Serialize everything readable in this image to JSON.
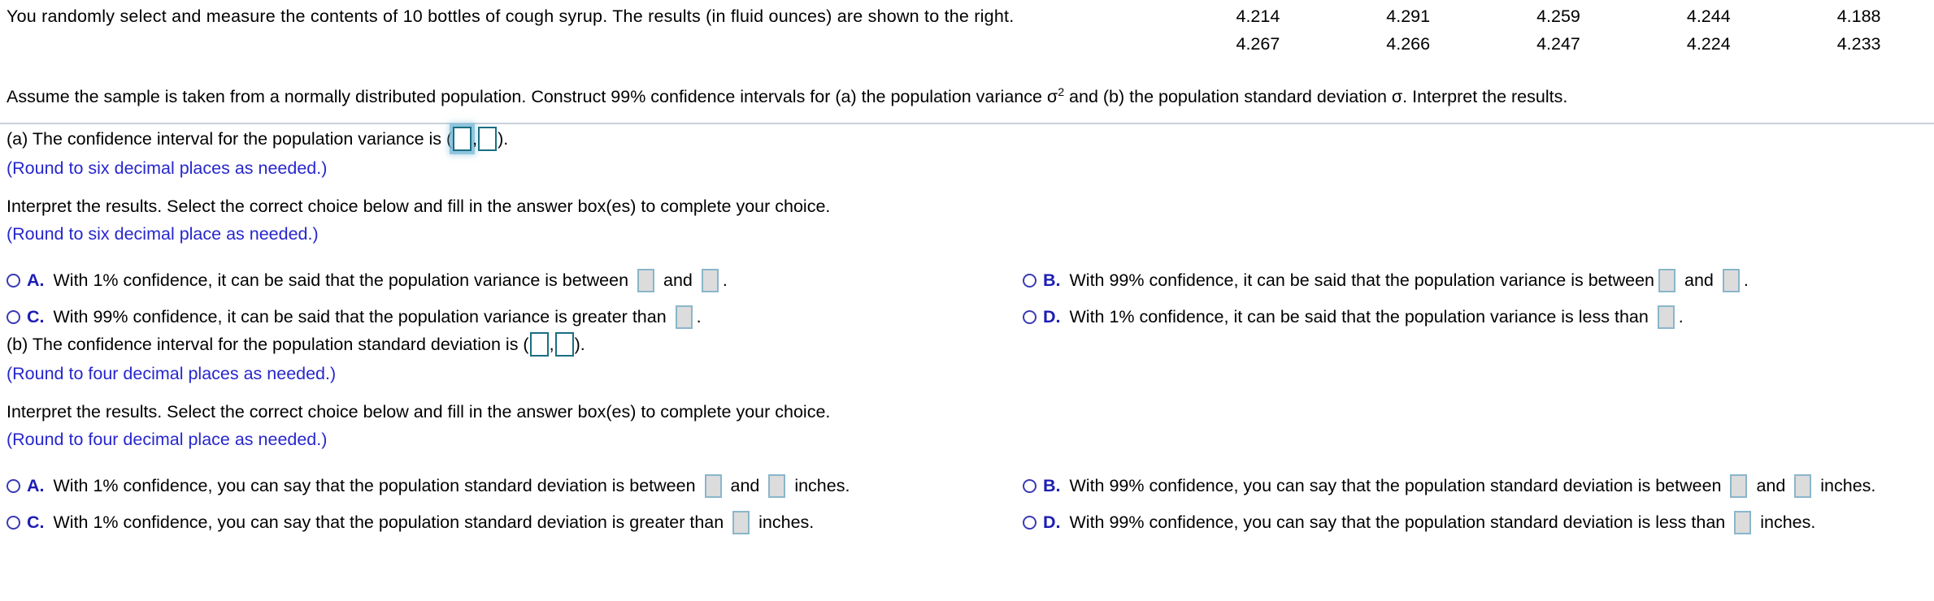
{
  "stem": {
    "text": "You randomly select and measure the contents of 10 bottles of cough syrup. The results (in fluid ounces) are shown to the right.",
    "assume_pre": "Assume the sample is taken from a normally distributed population. Construct 99% confidence intervals for (a) the population variance σ",
    "assume_sup": "2",
    "assume_post": " and (b) the population standard deviation σ. Interpret the results."
  },
  "data_table": {
    "rows": [
      [
        "4.214",
        "4.291",
        "4.259",
        "4.244",
        "4.188"
      ],
      [
        "4.267",
        "4.266",
        "4.247",
        "4.224",
        "4.233"
      ]
    ]
  },
  "part_a": {
    "prompt_pre": "(a) The confidence interval for the population variance is (",
    "prompt_mid": ",",
    "prompt_post": ").",
    "round_hint": "(Round to six decimal places as needed.)",
    "interpret": "Interpret the results. Select the correct choice below and fill in the answer box(es) to complete your choice.",
    "interpret_hint": "(Round to six decimal place as needed.)",
    "choices": [
      {
        "letter": "A.",
        "parts": [
          "With 1% confidence, it can be said that the population variance is between ",
          " and ",
          "."
        ],
        "boxes": 2
      },
      {
        "letter": "B.",
        "parts": [
          "With 99% confidence, it can be said that  the population variance is between",
          " and ",
          "."
        ],
        "boxes": 2
      },
      {
        "letter": "C.",
        "parts": [
          "With 99% confidence, it can be said that the population variance is greater than ",
          "."
        ],
        "boxes": 1
      },
      {
        "letter": "D.",
        "parts": [
          "With 1% confidence, it can be said that the population variance is less than ",
          "."
        ],
        "boxes": 1
      }
    ]
  },
  "part_b": {
    "prompt_pre": "(b) The confidence interval for the population standard deviation is (",
    "prompt_mid": ",",
    "prompt_post": ").",
    "round_hint": "(Round to four decimal places as needed.)",
    "interpret": "Interpret the results. Select the correct choice below and fill in the answer box(es) to complete your choice.",
    "interpret_hint": "(Round to four decimal place as needed.)",
    "choices": [
      {
        "letter": "A.",
        "parts": [
          "With 1% confidence, you can say that the population standard deviation is between ",
          " and ",
          " inches."
        ],
        "boxes": 2
      },
      {
        "letter": "B.",
        "parts": [
          "With 99% confidence, you can say that the population standard deviation is between ",
          " and ",
          " inches."
        ],
        "boxes": 2
      },
      {
        "letter": "C.",
        "parts": [
          "With 1% confidence, you can say that the population standard deviation is greater than ",
          " inches."
        ],
        "boxes": 1
      },
      {
        "letter": "D.",
        "parts": [
          "With 99% confidence, you can say that the population standard deviation is less than ",
          " inches."
        ],
        "boxes": 1
      }
    ]
  },
  "colors": {
    "hint_blue": "#2727cd",
    "letter_blue": "#1d1db4",
    "interval_box_border": "#1a6e82",
    "answer_box_border": "#8ab6ca",
    "answer_box_fill": "#dcdcdc",
    "focus_glow": "#78b9d7",
    "divider": "#c9d2dc"
  }
}
